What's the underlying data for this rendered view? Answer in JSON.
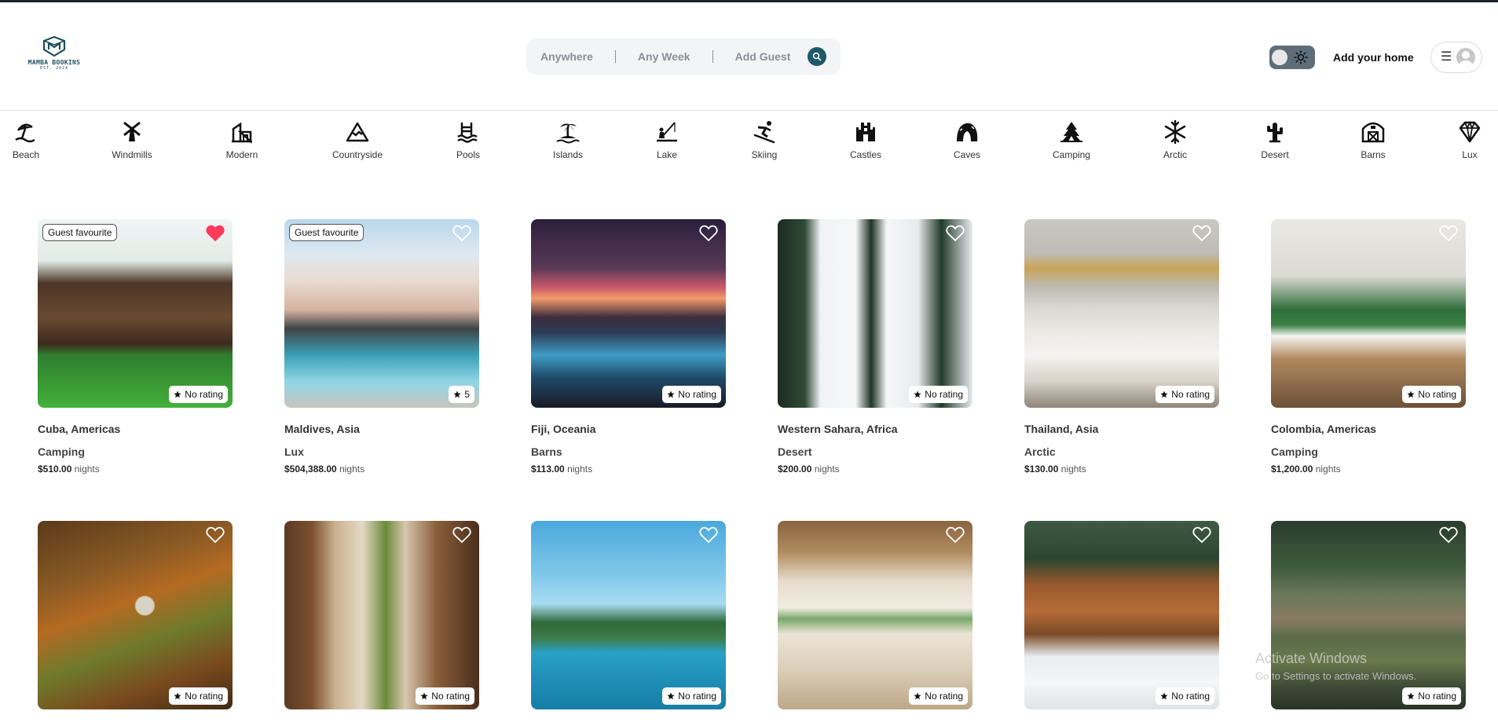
{
  "brand": {
    "name": "MAMBA BOOKINS",
    "est": "EST. 2024",
    "color": "#1e4f5c"
  },
  "search": {
    "anywhere": "Anywhere",
    "any_week": "Any Week",
    "add_guest": "Add Guest",
    "icon": "search-icon"
  },
  "header": {
    "add_home": "Add your home",
    "theme_toggle": "light",
    "menu_icon": "☰"
  },
  "categories": [
    {
      "label": "Beach",
      "icon": "beach-umbrella-icon"
    },
    {
      "label": "Windmills",
      "icon": "windmill-icon"
    },
    {
      "label": "Modern",
      "icon": "modern-building-icon"
    },
    {
      "label": "Countryside",
      "icon": "mountain-icon"
    },
    {
      "label": "Pools",
      "icon": "pool-icon"
    },
    {
      "label": "Islands",
      "icon": "island-icon"
    },
    {
      "label": "Lake",
      "icon": "lake-fishing-icon"
    },
    {
      "label": "Skiing",
      "icon": "skiing-icon"
    },
    {
      "label": "Castles",
      "icon": "castle-icon"
    },
    {
      "label": "Caves",
      "icon": "cave-icon"
    },
    {
      "label": "Camping",
      "icon": "camping-tent-icon"
    },
    {
      "label": "Arctic",
      "icon": "snowflake-icon"
    },
    {
      "label": "Desert",
      "icon": "cactus-icon"
    },
    {
      "label": "Barns",
      "icon": "barn-icon"
    },
    {
      "label": "Lux",
      "icon": "diamond-icon"
    }
  ],
  "listings": [
    {
      "badge": "Guest favourite",
      "favorited": true,
      "rating": "No rating",
      "location": "Cuba, Americas",
      "category": "Camping",
      "price": "$510.00",
      "unit": "nights",
      "photo": "wooden-house"
    },
    {
      "badge": "Guest favourite",
      "favorited": false,
      "rating": "5",
      "location": "Maldives, Asia",
      "category": "Lux",
      "price": "$504,388.00",
      "unit": "nights",
      "photo": "modern-villa-pool"
    },
    {
      "badge": "",
      "favorited": false,
      "rating": "No rating",
      "location": "Fiji, Oceania",
      "category": "Barns",
      "price": "$113.00",
      "unit": "nights",
      "photo": "sunset-pool"
    },
    {
      "badge": "",
      "favorited": false,
      "rating": "No rating",
      "location": "Western Sahara, Africa",
      "category": "Desert",
      "price": "$200.00",
      "unit": "nights",
      "photo": "snowy-aframe"
    },
    {
      "badge": "",
      "favorited": false,
      "rating": "No rating",
      "location": "Thailand, Asia",
      "category": "Arctic",
      "price": "$130.00",
      "unit": "nights",
      "photo": "bedroom"
    },
    {
      "badge": "",
      "favorited": false,
      "rating": "No rating",
      "location": "Colombia, Americas",
      "category": "Camping",
      "price": "$1,200.00",
      "unit": "nights",
      "photo": "living-room"
    },
    {
      "badge": "",
      "favorited": false,
      "rating": "No rating",
      "photo": "autumn-forest"
    },
    {
      "badge": "",
      "favorited": false,
      "rating": "No rating",
      "photo": "wood-interior"
    },
    {
      "badge": "",
      "favorited": false,
      "rating": "No rating",
      "photo": "island-sea"
    },
    {
      "badge": "",
      "favorited": false,
      "rating": "No rating",
      "photo": "attic-room"
    },
    {
      "badge": "",
      "favorited": false,
      "rating": "No rating",
      "photo": "treehouse-snow"
    },
    {
      "badge": "",
      "favorited": false,
      "rating": "No rating",
      "photo": "forest-cabin"
    }
  ],
  "watermark": {
    "line1": "Activate Windows",
    "line2": "Go to Settings to activate Windows."
  },
  "colors": {
    "accent": "#1e5a68",
    "heart_active": "#ff3b5c"
  }
}
